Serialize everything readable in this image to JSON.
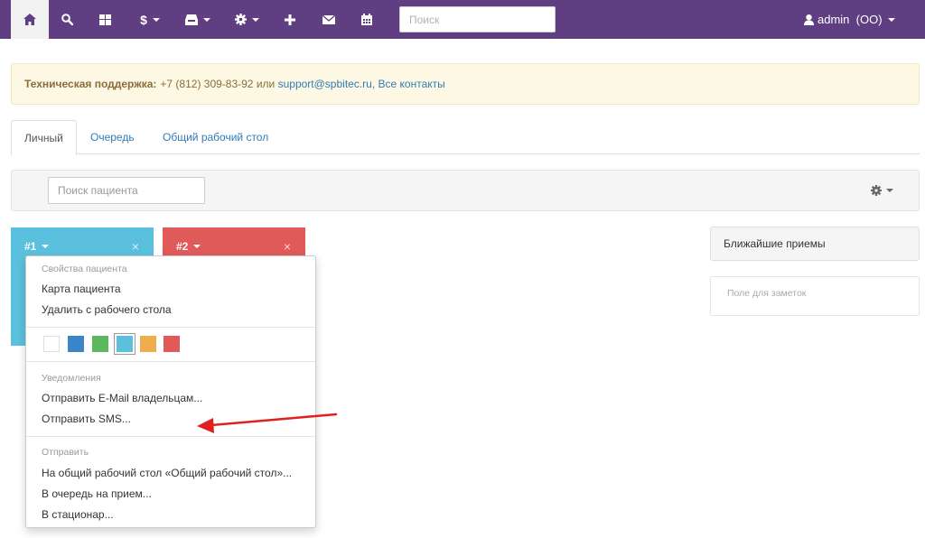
{
  "navbar": {
    "search_placeholder": "Поиск",
    "money_symbol": "$",
    "user_name": "admin",
    "user_org": "(ОО)"
  },
  "alert": {
    "label": "Техническая поддержка:",
    "phone": "+7 (812) 309-83-92",
    "or": "или",
    "email": "support@spbitec.ru,",
    "contacts": "Все контакты"
  },
  "tabs": [
    {
      "label": "Личный"
    },
    {
      "label": "Очередь"
    },
    {
      "label": "Общий рабочий стол"
    }
  ],
  "toolbar": {
    "patient_search_placeholder": "Поиск пациента"
  },
  "cards": [
    {
      "title": "#1",
      "color": "#5bc0de"
    },
    {
      "title": "#2",
      "color": "#e05a5a"
    }
  ],
  "card_close_symbol": "×",
  "dropdown": {
    "section_properties": "Свойства пациента",
    "item_card": "Карта пациента",
    "item_remove": "Удалить с рабочего стола",
    "colors": [
      "#ffffff",
      "#3a86c8",
      "#5cb85c",
      "#5bc0de",
      "#f0ad4e",
      "#e05a5a"
    ],
    "selected_color_index": 3,
    "section_notifications": "Уведомления",
    "item_email": "Отправить E-Mail владельцам...",
    "item_sms": "Отправить SMS...",
    "section_send": "Отправить",
    "item_common_desk": "На общий рабочий стол «Общий рабочий стол»...",
    "item_queue": "В очередь на прием...",
    "item_hospital": "В стационар..."
  },
  "right_panel": {
    "appointments_title": "Ближайшие приемы",
    "notes_placeholder": "Поле для заметок"
  },
  "colors": {
    "navbar": "#5f3e82",
    "arrow": "#e02020"
  }
}
